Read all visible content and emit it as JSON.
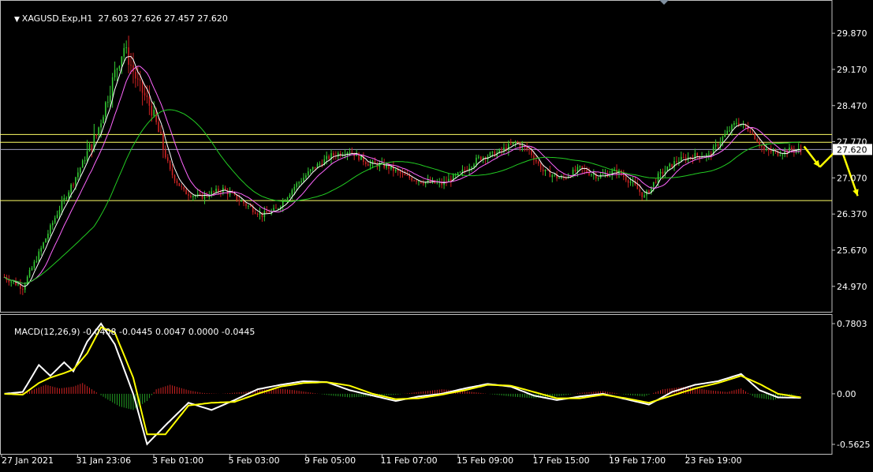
{
  "header": {
    "symbol": "XAGUSD.Exp,H1",
    "ohlc": "27.603 27.626 27.457 27.620"
  },
  "macd_header": {
    "text": "MACD(12,26,9) -0.0408 -0.0445 0.0047 0.0000 -0.0445"
  },
  "colors": {
    "background": "#000000",
    "axis": "#c0c0c0",
    "bull_candle": "#33cc33",
    "bear_candle": "#cc2222",
    "ma_fast": "#ffffff",
    "ma_mid": "#ff66ff",
    "ma_slow": "#22cc22",
    "level_line": "#ffff66",
    "current_price_line": "#a0a0c0",
    "macd_line": "#ffffff",
    "signal_line": "#ffff00",
    "hist_pos": "#cc2222",
    "hist_neg": "#229922",
    "forecast_arrow": "#ffff00"
  },
  "chart_data": [
    {
      "type": "candlestick",
      "title": "XAGUSD.Exp,H1",
      "ylim": [
        24.6,
        30.3
      ],
      "price_ticks": [
        "29.870",
        "29.170",
        "28.470",
        "27.770",
        "27.070",
        "26.370",
        "25.670",
        "24.970"
      ],
      "current_price": "27.620",
      "horizontal_levels": [
        27.91,
        27.76,
        26.63
      ],
      "current_price_line": 27.62,
      "time_ticks": [
        "27 Jan 2021",
        "31 Jan 23:06",
        "3 Feb 01:00",
        "5 Feb 03:00",
        "9 Feb 05:00",
        "11 Feb 07:00",
        "15 Feb 09:00",
        "17 Feb 15:00",
        "19 Feb 17:00",
        "23 Feb 19:00"
      ],
      "bars": 360,
      "price_path": [
        [
          0,
          25.15
        ],
        [
          8,
          24.95
        ],
        [
          15,
          25.6
        ],
        [
          22,
          26.3
        ],
        [
          30,
          27.0
        ],
        [
          40,
          27.9
        ],
        [
          48,
          29.1
        ],
        [
          52,
          29.6
        ],
        [
          58,
          28.9
        ],
        [
          64,
          28.4
        ],
        [
          72,
          27.2
        ],
        [
          78,
          26.8
        ],
        [
          85,
          26.7
        ],
        [
          95,
          26.85
        ],
        [
          105,
          26.55
        ],
        [
          112,
          26.35
        ],
        [
          118,
          26.45
        ],
        [
          126,
          26.9
        ],
        [
          134,
          27.25
        ],
        [
          142,
          27.5
        ],
        [
          150,
          27.6
        ],
        [
          158,
          27.35
        ],
        [
          166,
          27.3
        ],
        [
          174,
          27.1
        ],
        [
          182,
          27.0
        ],
        [
          190,
          26.95
        ],
        [
          198,
          27.15
        ],
        [
          206,
          27.45
        ],
        [
          214,
          27.55
        ],
        [
          222,
          27.75
        ],
        [
          228,
          27.6
        ],
        [
          234,
          27.2
        ],
        [
          242,
          27.05
        ],
        [
          250,
          27.25
        ],
        [
          258,
          27.1
        ],
        [
          266,
          27.2
        ],
        [
          272,
          27.0
        ],
        [
          278,
          26.7
        ],
        [
          284,
          27.1
        ],
        [
          292,
          27.4
        ],
        [
          300,
          27.5
        ],
        [
          306,
          27.5
        ],
        [
          312,
          27.85
        ],
        [
          318,
          28.15
        ],
        [
          324,
          28.0
        ],
        [
          330,
          27.6
        ],
        [
          336,
          27.55
        ],
        [
          342,
          27.62
        ],
        [
          346,
          27.6
        ]
      ],
      "forecast_arrow_path": [
        [
          27.68
        ],
        [
          27.28
        ],
        [
          27.68
        ],
        [
          26.72
        ]
      ]
    },
    {
      "type": "line",
      "title": "MACD(12,26,9)",
      "ylim": [
        -0.5625,
        0.7803
      ],
      "y_ticks": [
        "0.7803",
        "0.00",
        "-0.5625"
      ],
      "series": [
        {
          "name": "MACD(12,26,9)",
          "points": [
            [
              0,
              0.0
            ],
            [
              8,
              0.02
            ],
            [
              15,
              0.32
            ],
            [
              20,
              0.2
            ],
            [
              26,
              0.35
            ],
            [
              30,
              0.25
            ],
            [
              36,
              0.58
            ],
            [
              42,
              0.78
            ],
            [
              48,
              0.55
            ],
            [
              56,
              0.0
            ],
            [
              62,
              -0.56
            ],
            [
              70,
              -0.35
            ],
            [
              80,
              -0.1
            ],
            [
              90,
              -0.18
            ],
            [
              100,
              -0.07
            ],
            [
              110,
              0.05
            ],
            [
              120,
              0.1
            ],
            [
              130,
              0.14
            ],
            [
              140,
              0.13
            ],
            [
              150,
              0.04
            ],
            [
              160,
              -0.02
            ],
            [
              170,
              -0.08
            ],
            [
              180,
              -0.03
            ],
            [
              190,
              0.0
            ],
            [
              200,
              0.06
            ],
            [
              210,
              0.11
            ],
            [
              220,
              0.08
            ],
            [
              230,
              -0.02
            ],
            [
              240,
              -0.07
            ],
            [
              250,
              -0.03
            ],
            [
              260,
              0.0
            ],
            [
              270,
              -0.06
            ],
            [
              280,
              -0.12
            ],
            [
              290,
              0.02
            ],
            [
              300,
              0.1
            ],
            [
              310,
              0.14
            ],
            [
              320,
              0.22
            ],
            [
              328,
              0.04
            ],
            [
              336,
              -0.04
            ],
            [
              346,
              -0.045
            ]
          ]
        },
        {
          "name": "Signal",
          "points": [
            [
              0,
              0.0
            ],
            [
              8,
              -0.01
            ],
            [
              15,
              0.12
            ],
            [
              20,
              0.18
            ],
            [
              26,
              0.23
            ],
            [
              30,
              0.27
            ],
            [
              36,
              0.45
            ],
            [
              42,
              0.74
            ],
            [
              48,
              0.68
            ],
            [
              56,
              0.18
            ],
            [
              62,
              -0.45
            ],
            [
              70,
              -0.45
            ],
            [
              80,
              -0.13
            ],
            [
              90,
              -0.1
            ],
            [
              100,
              -0.09
            ],
            [
              110,
              0.0
            ],
            [
              120,
              0.08
            ],
            [
              130,
              0.12
            ],
            [
              140,
              0.13
            ],
            [
              150,
              0.09
            ],
            [
              160,
              0.0
            ],
            [
              170,
              -0.06
            ],
            [
              180,
              -0.05
            ],
            [
              190,
              -0.01
            ],
            [
              200,
              0.04
            ],
            [
              210,
              0.1
            ],
            [
              220,
              0.09
            ],
            [
              230,
              0.02
            ],
            [
              240,
              -0.05
            ],
            [
              250,
              -0.05
            ],
            [
              260,
              -0.01
            ],
            [
              270,
              -0.05
            ],
            [
              280,
              -0.1
            ],
            [
              290,
              -0.02
            ],
            [
              300,
              0.06
            ],
            [
              310,
              0.12
            ],
            [
              320,
              0.2
            ],
            [
              328,
              0.11
            ],
            [
              336,
              0.0
            ],
            [
              346,
              -0.04
            ]
          ]
        }
      ],
      "histogram": [
        [
          0,
          0.0
        ],
        [
          10,
          0.02
        ],
        [
          18,
          0.1
        ],
        [
          24,
          0.06
        ],
        [
          30,
          0.08
        ],
        [
          34,
          0.12
        ],
        [
          38,
          0.05
        ],
        [
          44,
          -0.05
        ],
        [
          50,
          -0.14
        ],
        [
          56,
          -0.18
        ],
        [
          62,
          -0.08
        ],
        [
          66,
          0.05
        ],
        [
          72,
          0.1
        ],
        [
          80,
          0.04
        ],
        [
          86,
          0.01
        ],
        [
          94,
          0.0
        ],
        [
          104,
          0.02
        ],
        [
          110,
          0.04
        ],
        [
          118,
          0.06
        ],
        [
          126,
          0.04
        ],
        [
          134,
          0.01
        ],
        [
          142,
          -0.02
        ],
        [
          150,
          -0.04
        ],
        [
          160,
          -0.03
        ],
        [
          170,
          -0.01
        ],
        [
          180,
          0.02
        ],
        [
          190,
          0.05
        ],
        [
          200,
          0.03
        ],
        [
          210,
          0.0
        ],
        [
          220,
          -0.03
        ],
        [
          230,
          -0.05
        ],
        [
          240,
          -0.03
        ],
        [
          250,
          0.01
        ],
        [
          260,
          0.03
        ],
        [
          270,
          -0.01
        ],
        [
          278,
          -0.03
        ],
        [
          286,
          0.05
        ],
        [
          296,
          0.08
        ],
        [
          306,
          0.04
        ],
        [
          314,
          0.02
        ],
        [
          320,
          0.06
        ],
        [
          326,
          -0.04
        ],
        [
          334,
          -0.07
        ],
        [
          340,
          -0.02
        ],
        [
          346,
          0.005
        ]
      ]
    }
  ]
}
